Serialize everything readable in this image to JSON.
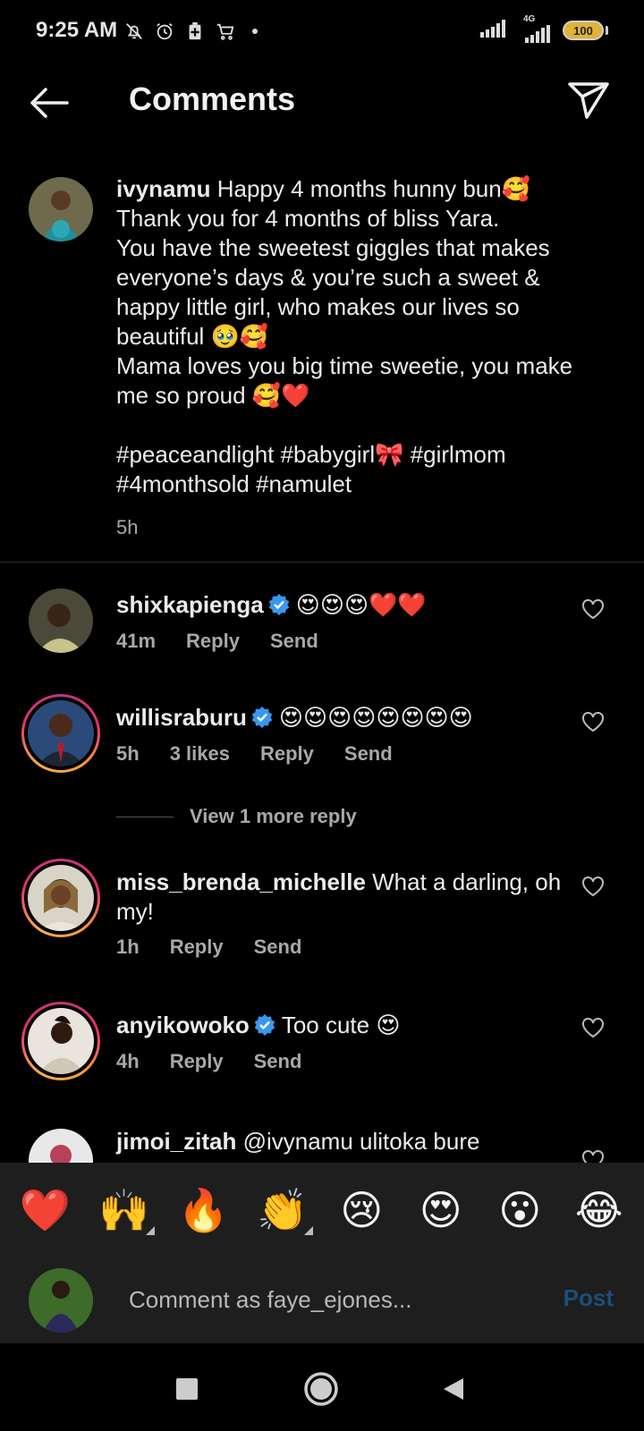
{
  "status_bar": {
    "time": "9:25 AM",
    "network_label": "4G",
    "battery": "100",
    "icons": [
      "mute-icon",
      "alarm-icon",
      "battery-saver-icon",
      "cart-icon",
      "signal-icon",
      "signal-4g-icon"
    ]
  },
  "header": {
    "title": "Comments"
  },
  "caption": {
    "username": "ivynamu",
    "text": " Happy 4 months hunny bun🥰\nThank you for 4 months of bliss Yara.\nYou have the sweetest giggles that makes everyone’s days & you’re such a sweet & happy little girl, who makes our lives so beautiful 🥹🥰\nMama loves you big time sweetie, you make me so proud 🥰❤️\n\n#peaceandlight #babygirl🎀 #girlmom\n#4monthsold #namulet",
    "time": "5h"
  },
  "comments": [
    {
      "username": "shixkapienga",
      "verified": true,
      "text": "😍😍😍❤️❤️",
      "time": "41m",
      "likes": "",
      "reply": "Reply",
      "send": "Send"
    },
    {
      "username": "willisraburu",
      "verified": true,
      "text": "😍😍😍😍😍😍😍😍",
      "time": "5h",
      "likes": "3 likes",
      "reply": "Reply",
      "send": "Send"
    },
    {
      "username": "miss_brenda_michelle",
      "verified": false,
      "text": " What a darling, oh my!",
      "time": "1h",
      "likes": "",
      "reply": "Reply",
      "send": "Send"
    },
    {
      "username": "anyikowoko",
      "verified": true,
      "text": "Too cute 😍",
      "time": "4h",
      "likes": "",
      "reply": "Reply",
      "send": "Send"
    },
    {
      "username": "jimoi_zitah",
      "verified": false,
      "text": " @ivynamu  ulitoka bure",
      "time": "",
      "likes": "",
      "reply": "",
      "send": ""
    }
  ],
  "view_more_replies": "View 1 more reply",
  "reactions": [
    "❤️",
    "🙌",
    "🔥",
    "👏",
    "😢",
    "😍",
    "😮",
    "😂"
  ],
  "compose": {
    "placeholder": "Comment as faye_ejones...",
    "post_label": "Post"
  },
  "colors": {
    "background": "#000000",
    "verified": "#3897f0",
    "story_ring_start": "#c13584",
    "story_ring_end": "#fcaf45",
    "post_disabled": "#1c4f7a"
  }
}
